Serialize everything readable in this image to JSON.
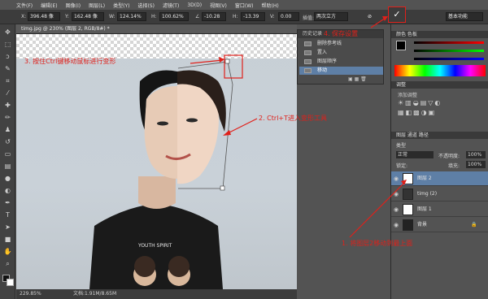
{
  "menu": [
    "文件(F)",
    "编辑(E)",
    "图像(I)",
    "图层(L)",
    "类型(Y)",
    "选择(S)",
    "滤镜(T)",
    "3D(D)",
    "视图(V)",
    "窗口(W)",
    "帮助(H)"
  ],
  "options": {
    "x_label": "X:",
    "x_value": "396.48 像",
    "y_label": "Y:",
    "y_value": "162.48 像",
    "w_label": "W:",
    "w_value": "124.14%",
    "h_label": "H:",
    "h_value": "100.62%",
    "angle_value": "-10.28",
    "h2_label": "H:",
    "h2_value": "-13.39",
    "v_label": "V:",
    "v_value": "0.00",
    "interp_label": "插值:",
    "interp_value": "两次立方",
    "workspace": "基本功能",
    "commit_icon": "✓"
  },
  "document": {
    "tab": "timg.jpg @ 230% (图层 2, RGB/8#) *"
  },
  "status": {
    "zoom": "229.85%",
    "doc": "文档:1.91M/8.65M"
  },
  "history": {
    "title": "历史记录",
    "items": [
      "删除参考线",
      "置入",
      "图层顺序",
      "移动"
    ]
  },
  "right": {
    "color_title": "颜色  色板",
    "adjust_title": "调整",
    "adjust_sub": "添加调整",
    "layers_title": "图层  通道  路径",
    "kind": "类型",
    "blend": "正常",
    "opacity_label": "不透明度:",
    "opacity_value": "100%",
    "lock_label": "锁定:",
    "fill_label": "填充:",
    "fill_value": "100%",
    "layers": [
      {
        "name": "图层 2"
      },
      {
        "name": "timg (2)"
      },
      {
        "name": "图层 1"
      },
      {
        "name": "背景"
      }
    ]
  },
  "annotations": {
    "save": "4. 保存设置",
    "ctrl_drag": "3. 按住Ctrl键移动鼠标进行变形",
    "ctrl_t": "2. Ctrl+T进入变形工具",
    "move_layer": "1. 将图层2移动到最上面"
  },
  "tools": [
    "move-icon",
    "marquee-icon",
    "lasso-icon",
    "quick-select-icon",
    "crop-icon",
    "eyedropper-icon",
    "healing-icon",
    "brush-icon",
    "stamp-icon",
    "history-brush-icon",
    "eraser-icon",
    "gradient-icon",
    "blur-icon",
    "dodge-icon",
    "pen-icon",
    "type-icon",
    "path-select-icon",
    "shape-icon",
    "hand-icon",
    "zoom-icon"
  ]
}
